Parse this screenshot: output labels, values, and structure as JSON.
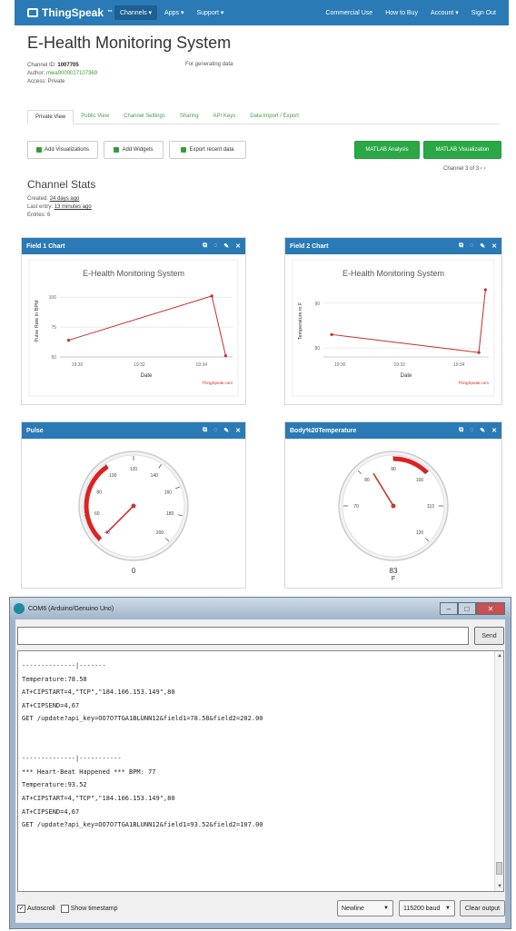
{
  "nav": {
    "logo": "ThingSpeak",
    "tm": "™",
    "left": [
      "Channels ▾",
      "Apps ▾",
      "Support ▾"
    ],
    "right": [
      "Commercial Use",
      "How to Buy",
      "Account ▾",
      "Sign Out"
    ]
  },
  "channel": {
    "title": "E-Health Monitoring System",
    "id_label": "Channel ID:",
    "id": "1007705",
    "author_label": "Author:",
    "author": "mwa0000017107369",
    "access": "Access: Private",
    "description": "For generating data"
  },
  "tabs": [
    "Private View",
    "Public View",
    "Channel Settings",
    "Sharing",
    "API Keys",
    "Data Import / Export"
  ],
  "buttons": {
    "add_vis": "Add Visualizations",
    "add_widgets": "Add Widgets",
    "export": "Export recent data",
    "matlab_analysis": "MATLAB Analysis",
    "matlab_vis": "MATLAB Visualization"
  },
  "pager": "Channel 3 of 3  ‹  ›",
  "stats": {
    "title": "Channel Stats",
    "created_label": "Created:",
    "created": "24 days ago",
    "last_label": "Last entry:",
    "last": "13 minutes ago",
    "entries": "Entries: 6"
  },
  "panels": {
    "field1": "Field 1 Chart",
    "field2": "Field 2 Chart",
    "pulse": "Pulse",
    "temp": "Body%20Temperature"
  },
  "chart_data": [
    {
      "type": "line",
      "title": "E-Health Monitoring System",
      "xlabel": "Date",
      "ylabel": "Pulse Rate in BPM",
      "x_ticks": [
        "19:30",
        "19:32",
        "19:34"
      ],
      "y_ticks": [
        50,
        75,
        100
      ],
      "ylim": [
        50,
        110
      ],
      "x": [
        0.05,
        0.88,
        0.96
      ],
      "values": [
        64,
        101,
        51
      ],
      "color": "#cc2a2a",
      "credit": "ThingSpeak.com"
    },
    {
      "type": "line",
      "title": "E-Health Monitoring System",
      "xlabel": "Date",
      "ylabel": "Temperature in F",
      "x_ticks": [
        "19:30",
        "19:32",
        "19:34"
      ],
      "y_ticks": [
        80,
        90
      ],
      "ylim": [
        78,
        94
      ],
      "x": [
        0.05,
        0.94,
        0.98
      ],
      "values": [
        83,
        79,
        93
      ],
      "color": "#cc2a2a",
      "credit": "ThingSpeak.com"
    }
  ],
  "gauges": [
    {
      "name": "Pulse",
      "min": 40,
      "max": 200,
      "ticks": [
        "40",
        "60",
        "80",
        "100",
        "120",
        "140",
        "160",
        "180",
        "200"
      ],
      "value": 0,
      "value_label": "0",
      "unit": "",
      "red_from": 40,
      "red_to": 100
    },
    {
      "name": "Body Temperature",
      "min": 60,
      "max": 120,
      "ticks": [
        "70",
        "80",
        "90",
        "100",
        "110",
        "120"
      ],
      "value": 83,
      "value_label": "83",
      "unit": "F",
      "red_from": 90,
      "red_to": 100
    }
  ],
  "arduino": {
    "title": "COM6 (Arduino/Genuino Uno)",
    "send": "Send",
    "lines": [
      "--------------|-------",
      "Temperature:78.58",
      "AT+CIPSTART=4,\"TCP\",\"184.106.153.149\",80",
      "AT+CIPSEND=4,67",
      "GET /update?api_key=OO7O7TGA1BLUNN12&field1=78.58&field2=202.00",
      "",
      "",
      "--------------|-----------",
      "*** Heart-Beat Happened *** BPM: 77",
      "Temperature:93.52",
      "AT+CIPSTART=4,\"TCP\",\"184.106.153.149\",80",
      "AT+CIPSEND=4,67",
      "GET /update?api_key=OO7O7TGA1BLUNN12&field1=93.52&field2=107.00"
    ],
    "autoscroll": "Autoscroll",
    "timestamp": "Show timestamp",
    "line_ending": "Newline",
    "baud": "115200 baud",
    "clear": "Clear output"
  }
}
